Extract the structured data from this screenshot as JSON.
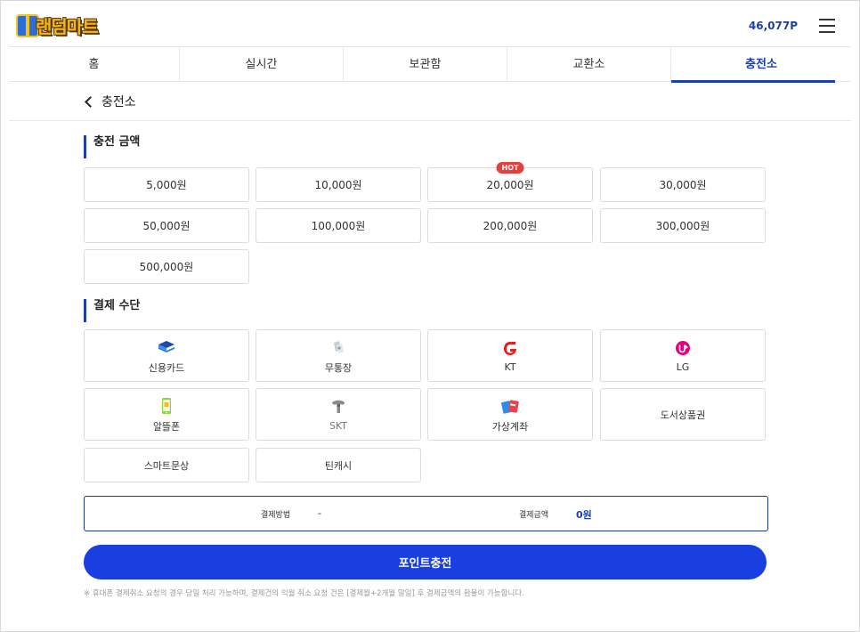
{
  "header": {
    "logo_text": "랜덤마트",
    "points": "46,077P"
  },
  "tabs": [
    {
      "label": "홈",
      "active": false
    },
    {
      "label": "실시간",
      "active": false
    },
    {
      "label": "보관함",
      "active": false
    },
    {
      "label": "교환소",
      "active": false
    },
    {
      "label": "충전소",
      "active": true
    }
  ],
  "page": {
    "back_label": "충전소"
  },
  "amount_section": {
    "title": "충전 금액",
    "options": [
      {
        "label": "5,000원"
      },
      {
        "label": "10,000원"
      },
      {
        "label": "20,000원",
        "badge": "HOT"
      },
      {
        "label": "30,000원"
      },
      {
        "label": "50,000원"
      },
      {
        "label": "100,000원"
      },
      {
        "label": "200,000원"
      },
      {
        "label": "300,000원"
      },
      {
        "label": "500,000원"
      }
    ]
  },
  "payment_section": {
    "title": "결제 수단",
    "methods": [
      {
        "label": "신용카드",
        "icon": "credit-card-icon"
      },
      {
        "label": "무통장",
        "icon": "bank-transfer-icon"
      },
      {
        "label": "KT",
        "icon": "kt-logo-icon"
      },
      {
        "label": "LG",
        "icon": "lg-uplus-logo-icon"
      },
      {
        "label": "알뜰폰",
        "icon": "mobile-phone-icon"
      },
      {
        "label": "SKT",
        "icon": "skt-logo-icon"
      },
      {
        "label": "가상계좌",
        "icon": "virtual-account-icon"
      },
      {
        "label": "도서상품권",
        "icon": ""
      },
      {
        "label": "스마트문상",
        "icon": ""
      },
      {
        "label": "틴캐시",
        "icon": ""
      }
    ]
  },
  "summary": {
    "method_label": "결제방법",
    "method_value": "-",
    "amount_label": "결제금액",
    "amount_value": "0원"
  },
  "charge_button": "포인트충전",
  "notice": "※ 휴대폰 결제취소 요청의 경우 당일 처리 가능하며, 결제건의 익월 취소 요청 건은 [결제월+2개월 말일] 후 결제금액의 환불이 가능합니다.",
  "colors": {
    "primary": "#1a3fe0",
    "accent_navy": "#1a3fb0",
    "hot": "#e43f3f"
  }
}
